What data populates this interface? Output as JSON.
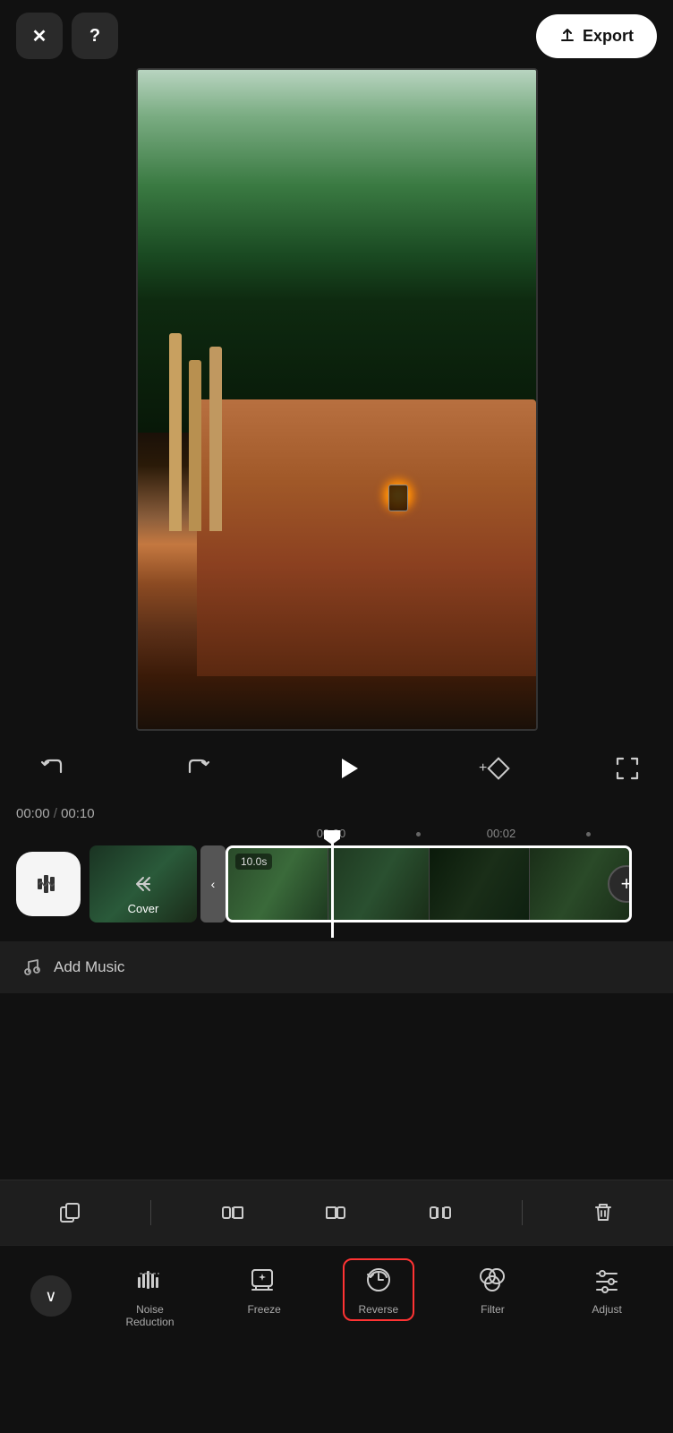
{
  "header": {
    "close_label": "✕",
    "help_label": "?",
    "export_label": "Export",
    "export_icon": "↑"
  },
  "controls": {
    "undo_label": "undo",
    "redo_label": "redo",
    "play_label": "play",
    "diamond_label": "keyframe",
    "fullscreen_label": "fullscreen"
  },
  "timeline": {
    "current_time": "00:00",
    "total_time": "00:10",
    "separator": "/",
    "marker_0": "00:00",
    "marker_2": "00:02",
    "clip_duration": "10.0s"
  },
  "audio": {
    "audio_icon": "🔊",
    "cover_label": "Cover",
    "chevron_label": "‹"
  },
  "music": {
    "icon": "♫",
    "label": "Add Music"
  },
  "edit_toolbar": {
    "copy_label": "copy",
    "trim_start_label": "trim_start",
    "trim_end_label": "trim_end",
    "trim_both_label": "trim_both",
    "delete_label": "delete"
  },
  "bottom_tools": {
    "collapse_label": "∨",
    "tools": [
      {
        "id": "noise-reduction",
        "icon": "noise",
        "label": "Noise\nReduction",
        "active": false
      },
      {
        "id": "freeze",
        "icon": "freeze",
        "label": "Freeze",
        "active": false
      },
      {
        "id": "reverse",
        "icon": "reverse",
        "label": "Reverse",
        "active": true
      },
      {
        "id": "filter",
        "icon": "filter",
        "label": "Filter",
        "active": false
      },
      {
        "id": "adjust",
        "icon": "adjust",
        "label": "Adjust",
        "active": false
      }
    ]
  },
  "colors": {
    "active_border": "#ff3333",
    "bg_dark": "#111111",
    "bg_panel": "#1e1e1e",
    "text_primary": "#ffffff",
    "text_muted": "#aaaaaa"
  }
}
